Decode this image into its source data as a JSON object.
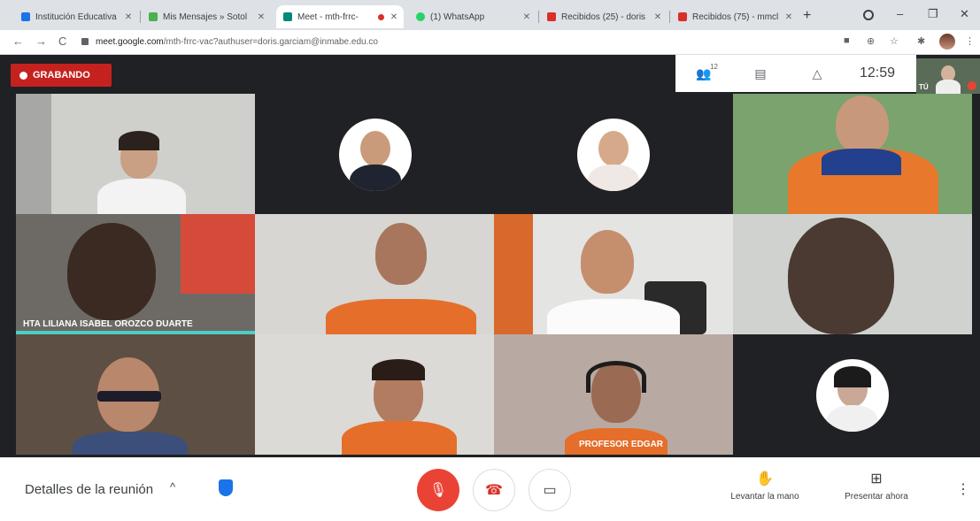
{
  "browser": {
    "tabs": [
      {
        "title": "Institución Educativa",
        "color": "#1a73e8",
        "active": false
      },
      {
        "title": "Mis Mensajes » Sotol",
        "color": "#4caf50",
        "active": false
      },
      {
        "title": "Meet - mth-frrc-",
        "color": "#00897b",
        "active": true,
        "recording": true
      },
      {
        "title": "(1) WhatsApp",
        "color": "#25d366",
        "active": false
      },
      {
        "title": "Recibidos (25) - doris",
        "color": "#d93025",
        "active": false
      },
      {
        "title": "Recibidos (75) - mmcl",
        "color": "#d93025",
        "active": false
      }
    ],
    "new_tab": "+",
    "window_controls": [
      "–",
      "❐",
      "✕"
    ],
    "url_host": "meet.google.com",
    "url_path": "/mth-frrc-vac?authuser=doris.garciam@inmabe.edu.co"
  },
  "meeting": {
    "recording_label": "GRABANDO",
    "participant_count": "12",
    "clock": "12:59",
    "self_label": "TÚ",
    "speaker_name": "HTA LILIANA ISABEL OROZCO DUARTE",
    "bottom_name": "PROFESOR EDGAR"
  },
  "controls": {
    "details_label": "Detalles de la reunión",
    "raise_hand_label": "Levantar la mano",
    "present_label": "Presentar ahora"
  },
  "colors": {
    "recording": "#c5221f",
    "hangup": "#d93025",
    "mic_off": "#ea4335",
    "meet_bg": "#202124"
  }
}
